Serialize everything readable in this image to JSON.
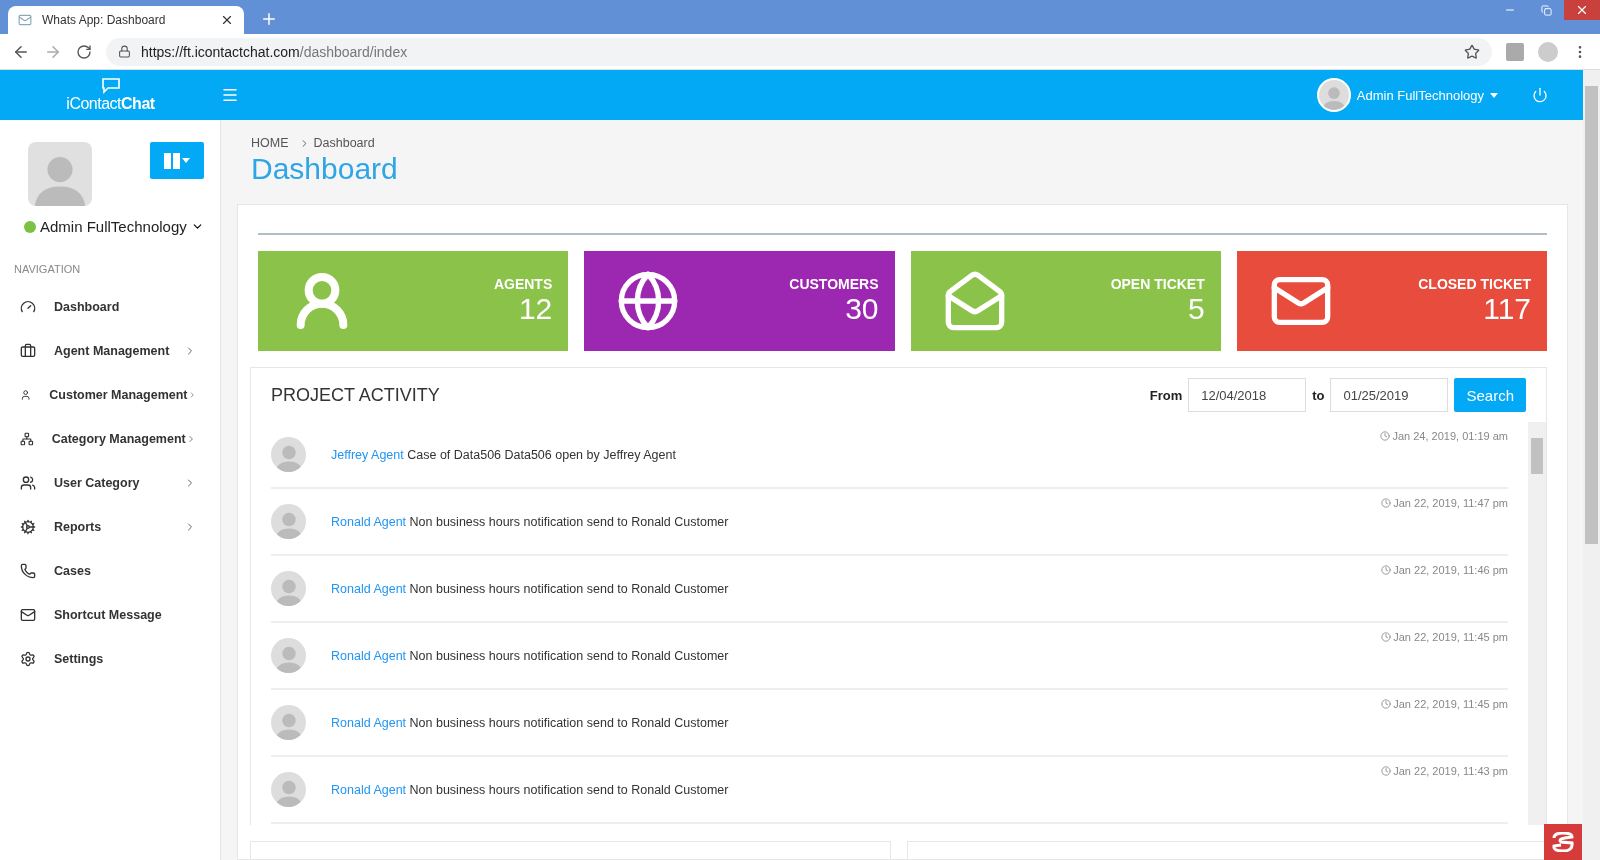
{
  "browser": {
    "tab_title": "Whats App: Dashboard",
    "url_host": "https://ft.icontactchat.com",
    "url_path": "/dashboard/index"
  },
  "header": {
    "logo_light": "iContact",
    "logo_bold": "Chat",
    "user": "Admin FullTechnology"
  },
  "sidebar": {
    "user": "Admin FullTechnology",
    "online": true,
    "section": "NAVIGATION",
    "items": [
      {
        "label": "Dashboard",
        "expandable": false
      },
      {
        "label": "Agent Management",
        "expandable": true
      },
      {
        "label": "Customer Management",
        "expandable": true
      },
      {
        "label": "Category Management",
        "expandable": true
      },
      {
        "label": "User Category",
        "expandable": true
      },
      {
        "label": "Reports",
        "expandable": true
      },
      {
        "label": "Cases",
        "expandable": false
      },
      {
        "label": "Shortcut Message",
        "expandable": false
      },
      {
        "label": "Settings",
        "expandable": false
      }
    ]
  },
  "breadcrumb": {
    "home": "HOME",
    "current": "Dashboard"
  },
  "page_title": "Dashboard",
  "stats": [
    {
      "label": "AGENTS",
      "value": "12",
      "color": "#8bc34a"
    },
    {
      "label": "CUSTOMERS",
      "value": "30",
      "color": "#9c27b0"
    },
    {
      "label": "OPEN TICKET",
      "value": "5",
      "color": "#8bc34a"
    },
    {
      "label": "CLOSED TICKET",
      "value": "117",
      "color": "#e74c3c"
    }
  ],
  "activity": {
    "title": "PROJECT ACTIVITY",
    "from_label": "From",
    "from_value": "12/04/2018",
    "to_label": "to",
    "to_value": "01/25/2019",
    "search_button": "Search",
    "rows": [
      {
        "user": "Jeffrey Agent",
        "text": "Case of Data506 Data506 open by Jeffrey Agent",
        "time": "Jan 24, 2019, 01:19 am"
      },
      {
        "user": "Ronald Agent",
        "text": "Non business hours notification send to Ronald Customer",
        "time": "Jan 22, 2019, 11:47 pm"
      },
      {
        "user": "Ronald Agent",
        "text": "Non business hours notification send to Ronald Customer",
        "time": "Jan 22, 2019, 11:46 pm"
      },
      {
        "user": "Ronald Agent",
        "text": "Non business hours notification send to Ronald Customer",
        "time": "Jan 22, 2019, 11:45 pm"
      },
      {
        "user": "Ronald Agent",
        "text": "Non business hours notification send to Ronald Customer",
        "time": "Jan 22, 2019, 11:45 pm"
      },
      {
        "user": "Ronald Agent",
        "text": "Non business hours notification send to Ronald Customer",
        "time": "Jan 22, 2019, 11:43 pm"
      }
    ]
  }
}
